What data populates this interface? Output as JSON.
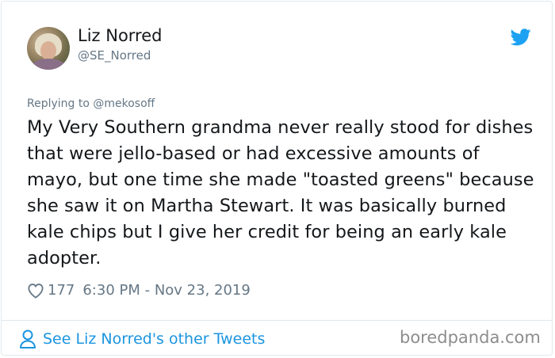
{
  "tweet": {
    "author_name": "Liz Norred",
    "author_handle": "@SE_Norred",
    "reply_context": "Replying to @mekosoff",
    "text": "My Very Southern grandma never really stood for dishes that were jello-based or had excessive amounts of mayo, but one time she made \"toasted greens\" because she saw it on Martha Stewart. It was basically burned kale chips but I give her credit for being an early kale adopter.",
    "likes": "177",
    "timestamp": "6:30 PM - Nov 23, 2019"
  },
  "footer": {
    "link_label": "See Liz Norred's other Tweets",
    "watermark": "boredpanda.com"
  },
  "icons": {
    "brand": "twitter-bird-icon",
    "like": "heart-icon",
    "profile": "person-icon"
  },
  "colors": {
    "accent": "#1da1f2",
    "link": "#1b95e0",
    "secondary_text": "#657786",
    "border": "#e1e8ed"
  }
}
